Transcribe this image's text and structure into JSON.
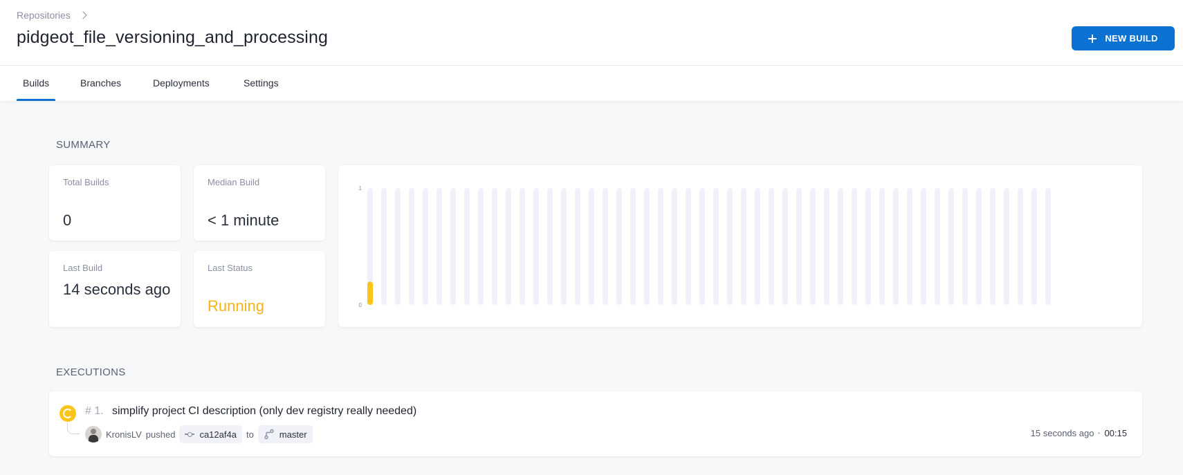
{
  "header": {
    "breadcrumb": {
      "label": "Repositories",
      "icon": "chevron-right-icon"
    },
    "title": "pidgeot_file_versioning_and_processing",
    "new_build_label": "NEW BUILD",
    "new_build_icon": "plus-icon"
  },
  "tabs": [
    {
      "label": "Builds",
      "active": true
    },
    {
      "label": "Branches",
      "active": false
    },
    {
      "label": "Deployments",
      "active": false
    },
    {
      "label": "Settings",
      "active": false
    }
  ],
  "summary": {
    "title": "SUMMARY",
    "total_builds": {
      "label": "Total Builds",
      "value": "0"
    },
    "median_build": {
      "label": "Median Build",
      "value": "< 1 minute"
    },
    "last_build": {
      "label": "Last Build",
      "value": "14 seconds ago"
    },
    "last_status": {
      "label": "Last Status",
      "value": "Running"
    }
  },
  "chart_data": {
    "type": "bar",
    "title": "",
    "xlabel": "",
    "ylabel": "",
    "ylim": [
      0,
      1
    ],
    "yticks": [
      "1",
      "0"
    ],
    "bar_count": 50,
    "values": [
      0.2,
      0,
      0,
      0,
      0,
      0,
      0,
      0,
      0,
      0,
      0,
      0,
      0,
      0,
      0,
      0,
      0,
      0,
      0,
      0,
      0,
      0,
      0,
      0,
      0,
      0,
      0,
      0,
      0,
      0,
      0,
      0,
      0,
      0,
      0,
      0,
      0,
      0,
      0,
      0,
      0,
      0,
      0,
      0,
      0,
      0,
      0,
      0,
      0,
      0
    ],
    "bar_colors": {
      "running": "#fcc419",
      "track": "#f0f1f9"
    },
    "grid": false,
    "legend": "none"
  },
  "executions": {
    "title": "EXECUTIONS",
    "items": [
      {
        "status": "running",
        "status_icon": "running-status-icon",
        "number": "# 1.",
        "title": "simplify project CI description (only dev registry really needed)",
        "author": "KronisLV",
        "action": "pushed",
        "commit": "ca12af4a",
        "to_label": "to",
        "branch": "master",
        "time_ago": "15 seconds ago",
        "duration": "00:15"
      }
    ]
  },
  "colors": {
    "accent": "#0b72d1",
    "running": "#f5b21a",
    "background": "#f7f8fa"
  }
}
